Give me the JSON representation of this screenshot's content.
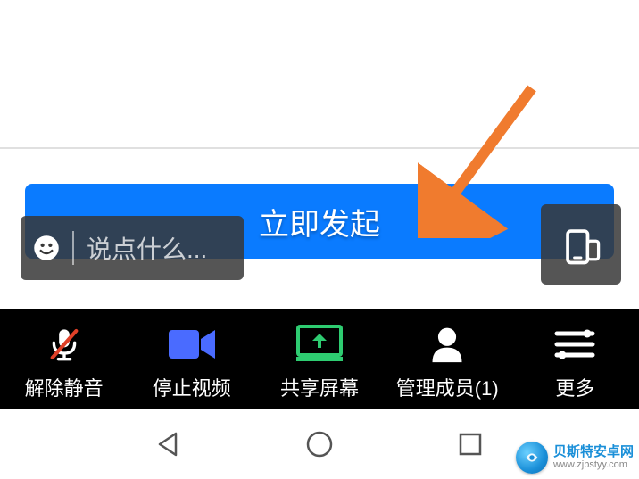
{
  "middle": {
    "start_button_label": "立即发起",
    "input_placeholder": "说点什么..."
  },
  "toolbar": {
    "items": [
      {
        "label": "解除静音"
      },
      {
        "label": "停止视频"
      },
      {
        "label": "共享屏幕"
      },
      {
        "label": "管理成员(1)"
      },
      {
        "label": "更多"
      }
    ]
  },
  "watermark": {
    "title": "贝斯特安卓网",
    "url": "www.zjbstyy.com"
  },
  "colors": {
    "primary_blue": "#0a7bff",
    "arrow": "#f07b2e",
    "share_green": "#2ecc71"
  }
}
